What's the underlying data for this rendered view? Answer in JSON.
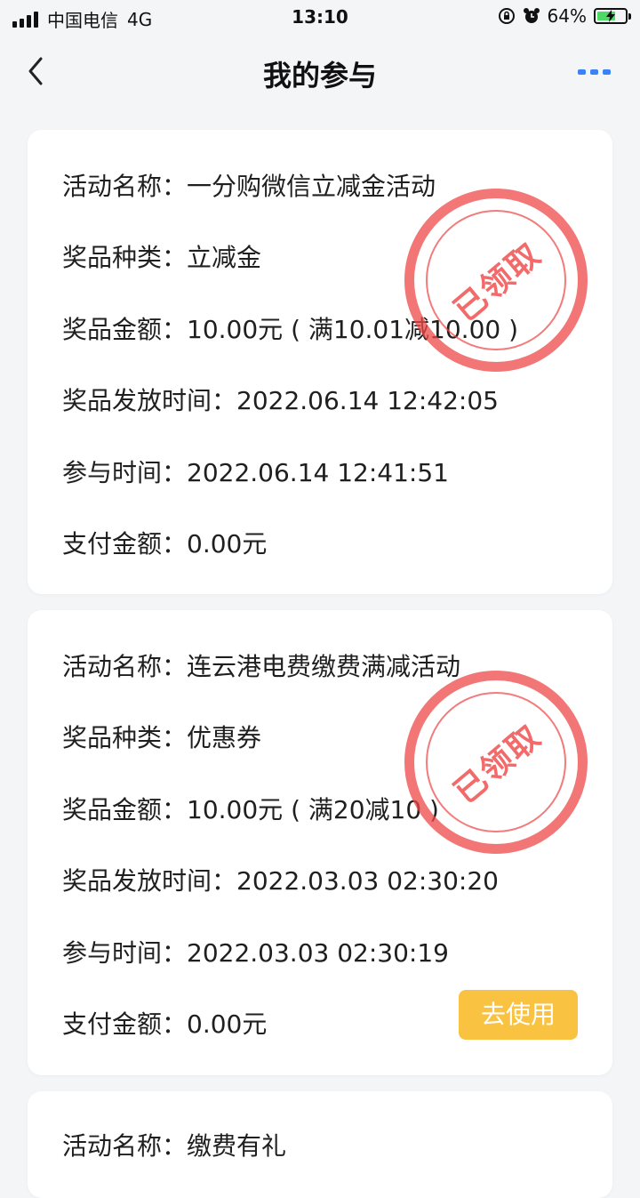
{
  "status_bar": {
    "carrier": "中国电信",
    "network": "4G",
    "time": "13:10",
    "battery_percent": "64%",
    "icons": [
      "signal-icon",
      "orientation-lock-icon",
      "alarm-icon",
      "battery-charging-icon"
    ]
  },
  "nav": {
    "title": "我的参与",
    "accent_color": "#3b82f6"
  },
  "stamp_text": "已领取",
  "stamp_color": "#ee4646",
  "records": [
    {
      "activity_label": "活动名称：",
      "activity_name": "一分购微信立减金活动",
      "prize_type_label": "奖品种类：",
      "prize_type": "立减金",
      "prize_amount_label": "奖品金额：",
      "prize_amount": "10.00元 ( 满10.01减10.00 )",
      "issue_time_label": "奖品发放时间：",
      "issue_time": "2022.06.14 12:42:05",
      "join_time_label": "参与时间：",
      "join_time": "2022.06.14 12:41:51",
      "paid_label": "支付金额：",
      "paid": "0.00元"
    },
    {
      "activity_label": "活动名称：",
      "activity_name": "连云港电费缴费满减活动",
      "prize_type_label": "奖品种类：",
      "prize_type": "优惠券",
      "prize_amount_label": "奖品金额：",
      "prize_amount": "10.00元 ( 满20减10 )",
      "issue_time_label": "奖品发放时间：",
      "issue_time": "2022.03.03 02:30:20",
      "join_time_label": "参与时间：",
      "join_time": "2022.03.03 02:30:19",
      "paid_label": "支付金额：",
      "paid": "0.00元",
      "use_button": "去使用"
    },
    {
      "activity_label": "活动名称：",
      "activity_name": "缴费有礼"
    }
  ]
}
